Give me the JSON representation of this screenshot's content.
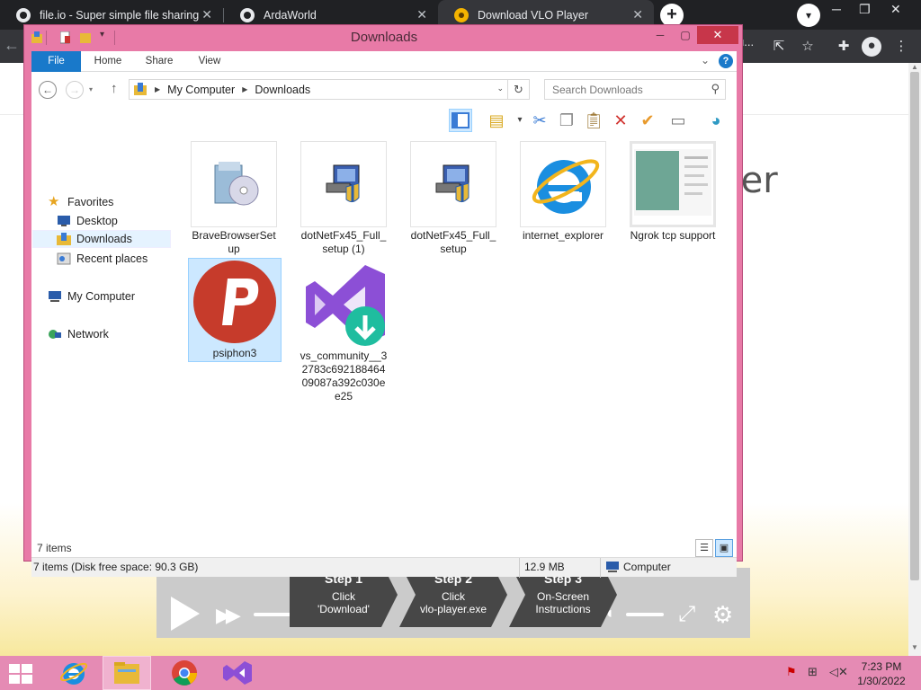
{
  "browser": {
    "tabs": [
      {
        "title": "file.io - Super simple file sharing",
        "close": "✕"
      },
      {
        "title": "ArdaWorld",
        "close": "✕"
      },
      {
        "title": "Download VLO Player",
        "close": "✕"
      }
    ],
    "new_tab": "+",
    "omnibox_tail": "u..."
  },
  "page": {
    "heading_fragment": "yer",
    "steps": [
      {
        "title": "Step 1",
        "line1": "Click",
        "line2": "'Download'"
      },
      {
        "title": "Step 2",
        "line1": "Click",
        "line2": "vlo-player.exe"
      },
      {
        "title": "Step 3",
        "line1": "On-Screen",
        "line2": "Instructions"
      }
    ]
  },
  "explorer": {
    "title": "Downloads",
    "ribbon_tabs": [
      "File",
      "Home",
      "Share",
      "View"
    ],
    "address": {
      "crumbs": [
        "My Computer",
        "Downloads"
      ]
    },
    "search": {
      "placeholder": "Search Downloads"
    },
    "nav_pane": {
      "favorites": "Favorites",
      "desktop": "Desktop",
      "downloads": "Downloads",
      "recent": "Recent places",
      "computer": "My Computer",
      "network": "Network"
    },
    "files": [
      {
        "name": "BraveBrowserSetup",
        "selected": false
      },
      {
        "name": "dotNetFx45_Full_setup (1)",
        "selected": false
      },
      {
        "name": "dotNetFx45_Full_setup",
        "selected": false
      },
      {
        "name": "internet_explorer",
        "selected": false
      },
      {
        "name": "Ngrok tcp support",
        "selected": false
      },
      {
        "name": "psiphon3",
        "selected": true
      },
      {
        "name": "vs_community__32783c69218846409087a392c030ee25",
        "selected": false
      }
    ],
    "item_count": "7 items",
    "status": {
      "summary": "7 items (Disk free space: 90.3 GB)",
      "size": "12.9 MB",
      "location": "Computer"
    }
  },
  "taskbar": {
    "time": "7:23 PM",
    "date": "1/30/2022"
  },
  "colors": {
    "window_frame": "#e87aa7",
    "taskbar": "#e58bb4",
    "ribbon_file": "#1979ca",
    "chrome_dark": "#202124"
  }
}
